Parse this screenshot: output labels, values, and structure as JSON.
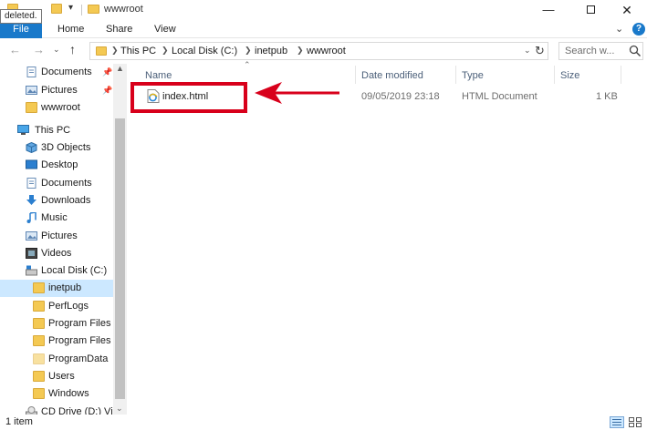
{
  "titlebar": {
    "tooltip": "deleted.",
    "title": "wwwroot",
    "minimize_icon": "minimize-icon",
    "maximize_icon": "maximize-icon",
    "close_icon": "close-icon"
  },
  "ribbon": {
    "file": "File",
    "home": "Home",
    "share": "Share",
    "view": "View"
  },
  "address": {
    "crumbs": [
      "This PC",
      "Local Disk (C:)",
      "inetpub",
      "wwwroot"
    ]
  },
  "search": {
    "placeholder": "Search w..."
  },
  "navpane": {
    "items": [
      {
        "label": "Documents",
        "icon": "documents-icon",
        "pinned": true
      },
      {
        "label": "Pictures",
        "icon": "pictures-icon",
        "pinned": true
      },
      {
        "label": "wwwroot",
        "icon": "folder-icon",
        "pinned": false
      },
      {
        "label": "This PC",
        "icon": "computer-icon",
        "pinned": false
      },
      {
        "label": "3D Objects",
        "icon": "3d-objects-icon",
        "pinned": false
      },
      {
        "label": "Desktop",
        "icon": "desktop-icon",
        "pinned": false
      },
      {
        "label": "Documents",
        "icon": "documents-icon",
        "pinned": false
      },
      {
        "label": "Downloads",
        "icon": "downloads-icon",
        "pinned": false
      },
      {
        "label": "Music",
        "icon": "music-icon",
        "pinned": false
      },
      {
        "label": "Pictures",
        "icon": "pictures-icon",
        "pinned": false
      },
      {
        "label": "Videos",
        "icon": "videos-icon",
        "pinned": false
      },
      {
        "label": "Local Disk (C:)",
        "icon": "local-disk-icon",
        "pinned": false
      },
      {
        "label": "inetpub",
        "icon": "folder-icon",
        "pinned": false,
        "selected": true
      },
      {
        "label": "PerfLogs",
        "icon": "folder-icon",
        "pinned": false
      },
      {
        "label": "Program Files",
        "icon": "folder-icon",
        "pinned": false
      },
      {
        "label": "Program Files (",
        "icon": "folder-icon",
        "pinned": false
      },
      {
        "label": "ProgramData",
        "icon": "folder-icon",
        "pinned": false
      },
      {
        "label": "Users",
        "icon": "folder-icon",
        "pinned": false
      },
      {
        "label": "Windows",
        "icon": "folder-icon",
        "pinned": false
      },
      {
        "label": "CD Drive (D:) Vir",
        "icon": "cd-drive-icon",
        "pinned": false
      }
    ]
  },
  "filelist": {
    "columns": {
      "name": "Name",
      "date": "Date modified",
      "type": "Type",
      "size": "Size"
    },
    "rows": [
      {
        "name": "index.html",
        "date": "09/05/2019 23:18",
        "type": "HTML Document",
        "size": "1 KB",
        "icon": "html-file-icon"
      }
    ]
  },
  "annotation": {
    "color": "#d8001b"
  },
  "status": {
    "count": "1 item"
  },
  "colors": {
    "accent": "#1979ca",
    "selection": "#cce8ff",
    "folder": "#f4c953"
  }
}
